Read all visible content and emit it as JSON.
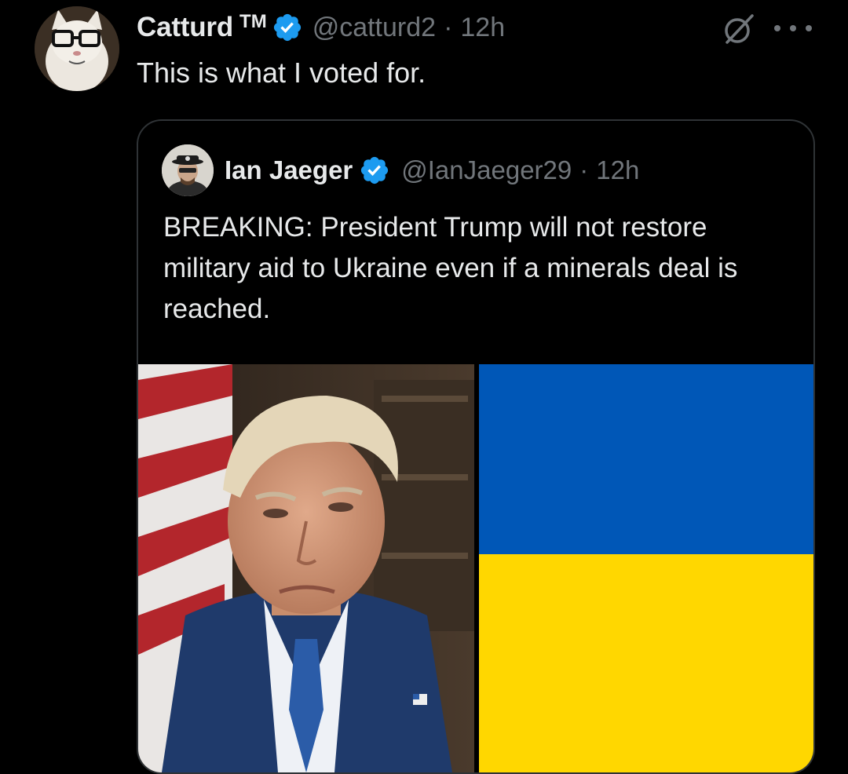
{
  "tweet": {
    "author": {
      "display_name": "Catturd",
      "tm": "TM",
      "handle": "@catturd2",
      "separator": "·",
      "time": "12h",
      "verified": true
    },
    "text": "This is what I voted for.",
    "icons": [
      "grok-icon",
      "more-icon",
      "verified-badge-icon"
    ]
  },
  "quoted_tweet": {
    "author": {
      "display_name": "Ian Jaeger",
      "handle": "@IanJaeger29",
      "separator": "·",
      "time": "12h",
      "verified": true
    },
    "text": "BREAKING: President Trump will not restore military aid to Ukraine even if a minerals deal is reached.",
    "media": [
      {
        "kind": "photo",
        "subject": "portrait"
      },
      {
        "kind": "photo",
        "subject": "flag",
        "colors": [
          "#0057b7",
          "#ffd700"
        ]
      }
    ]
  },
  "colors": {
    "background": "#000000",
    "text_primary": "#e7e9ea",
    "text_secondary": "#71767b",
    "verified_blue": "#1d9bf0",
    "border": "#2f3336"
  }
}
